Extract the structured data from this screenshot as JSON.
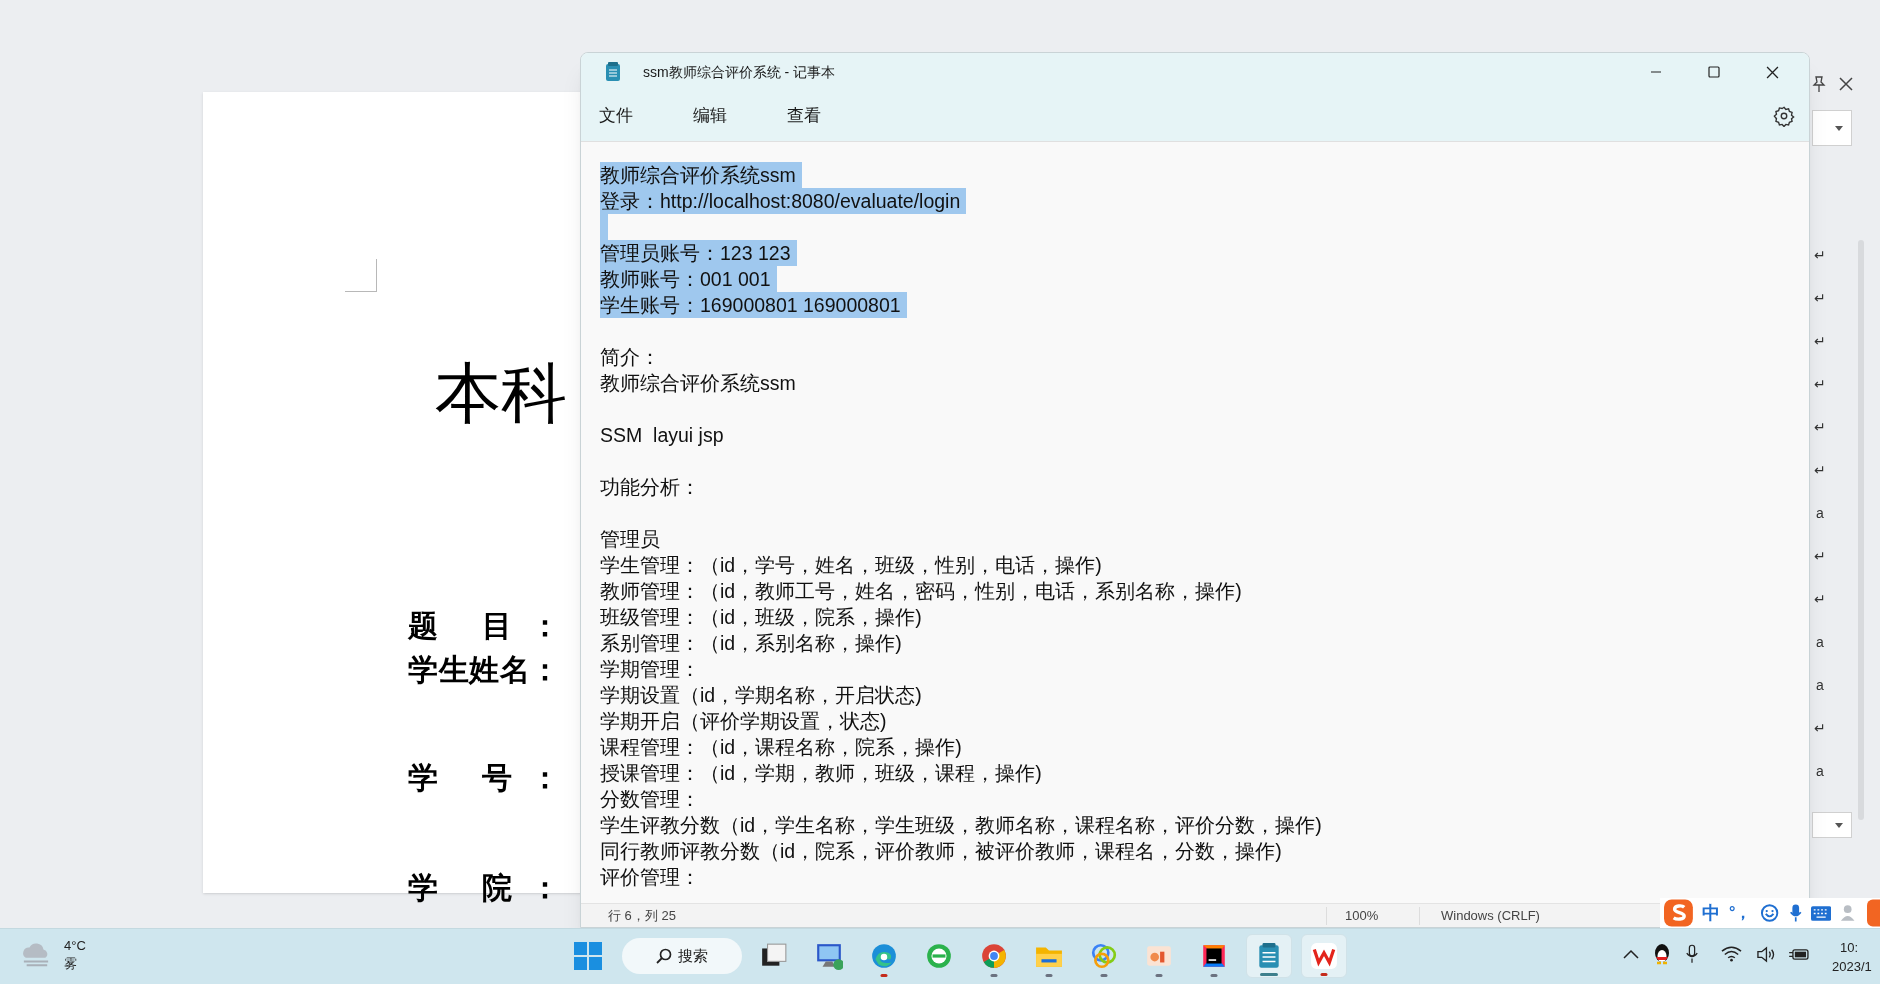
{
  "word_document": {
    "heading": "本科",
    "fields": [
      "题 目：",
      "学生姓名：",
      "学 号：",
      "学 院："
    ],
    "marks": [
      "↵",
      "↵",
      "↵",
      "↵",
      "↵",
      "↵",
      "a",
      "↵",
      "↵",
      "a",
      "a",
      "↵",
      "a"
    ]
  },
  "notepad": {
    "title": "ssm教师综合评价系统 - 记事本",
    "menu": [
      "文件",
      "编辑",
      "查看"
    ],
    "lines": [
      {
        "text": "教师综合评价系统ssm",
        "selected": true
      },
      {
        "text": "登录：http://localhost:8080/evaluate/login",
        "selected": true
      },
      {
        "kind": "blank",
        "selected": true
      },
      {
        "text": "管理员账号：123 123",
        "selected": true
      },
      {
        "text": "教师账号：001 001",
        "selected": true
      },
      {
        "text": "学生账号：169000801 169000801",
        "selected": true
      },
      {
        "kind": "blank",
        "selected": false
      },
      {
        "text": "简介：",
        "selected": false
      },
      {
        "text": "教师综合评价系统ssm",
        "selected": false
      },
      {
        "kind": "blank",
        "selected": false
      },
      {
        "text": "SSM  layui jsp",
        "selected": false
      },
      {
        "kind": "blank",
        "selected": false
      },
      {
        "text": "功能分析：",
        "selected": false
      },
      {
        "kind": "blank",
        "selected": false
      },
      {
        "text": "管理员",
        "selected": false
      },
      {
        "text": "学生管理：（id，学号，姓名，班级，性别，电话，操作)",
        "selected": false
      },
      {
        "text": "教师管理：（id，教师工号，姓名，密码，性别，电话，系别名称，操作)",
        "selected": false
      },
      {
        "text": "班级管理：（id，班级，院系，操作)",
        "selected": false
      },
      {
        "text": "系别管理：（id，系别名称，操作)",
        "selected": false
      },
      {
        "text": "学期管理：",
        "selected": false
      },
      {
        "text": "学期设置（id，学期名称，开启状态)",
        "selected": false
      },
      {
        "text": "学期开启（评价学期设置，状态)",
        "selected": false
      },
      {
        "text": "课程管理：（id，课程名称，院系，操作)",
        "selected": false
      },
      {
        "text": "授课管理：（id，学期，教师，班级，课程，操作)",
        "selected": false
      },
      {
        "text": "分数管理：",
        "selected": false
      },
      {
        "text": "学生评教分数（id，学生名称，学生班级，教师名称，课程名称，评价分数，操作)",
        "selected": false
      },
      {
        "text": "同行教师评教分数（id，院系，评价教师，被评价教师，课程名，分数，操作)",
        "selected": false
      },
      {
        "text": "评价管理：",
        "selected": false
      }
    ],
    "status_bar": {
      "position": "行 6，列 25",
      "zoom": "100%",
      "line_ending": "Windows (CRLF)"
    }
  },
  "ime_toolbar": {
    "mode": "中",
    "punctuation": "°，"
  },
  "taskbar": {
    "weather": {
      "temperature": "4°C",
      "condition": "雾"
    },
    "search": "搜索",
    "apps": [
      {
        "kind": "task-view",
        "running": false,
        "active": false
      },
      {
        "kind": "remote-desktop",
        "running": false,
        "active": false
      },
      {
        "kind": "edge",
        "running": true,
        "active": false,
        "color": "#c42b1c"
      },
      {
        "kind": "browser-360",
        "running": false,
        "active": false
      },
      {
        "kind": "chrome",
        "running": true,
        "active": false,
        "color": "#6b7280"
      },
      {
        "kind": "folder",
        "running": true,
        "active": false,
        "color": "#6b7280"
      },
      {
        "kind": "circles",
        "running": true,
        "active": false,
        "color": "#6b7280"
      },
      {
        "kind": "slides",
        "running": true,
        "active": false,
        "color": "#6b7280"
      },
      {
        "kind": "ide",
        "running": true,
        "active": false,
        "color": "#6b7280"
      },
      {
        "kind": "notepad",
        "running": true,
        "active": true,
        "color": "#3d7f8c"
      },
      {
        "kind": "wps",
        "running": true,
        "active": true,
        "color": "#c42b1c"
      }
    ],
    "clock": {
      "time": "10:",
      "date": "2023/1"
    }
  }
}
